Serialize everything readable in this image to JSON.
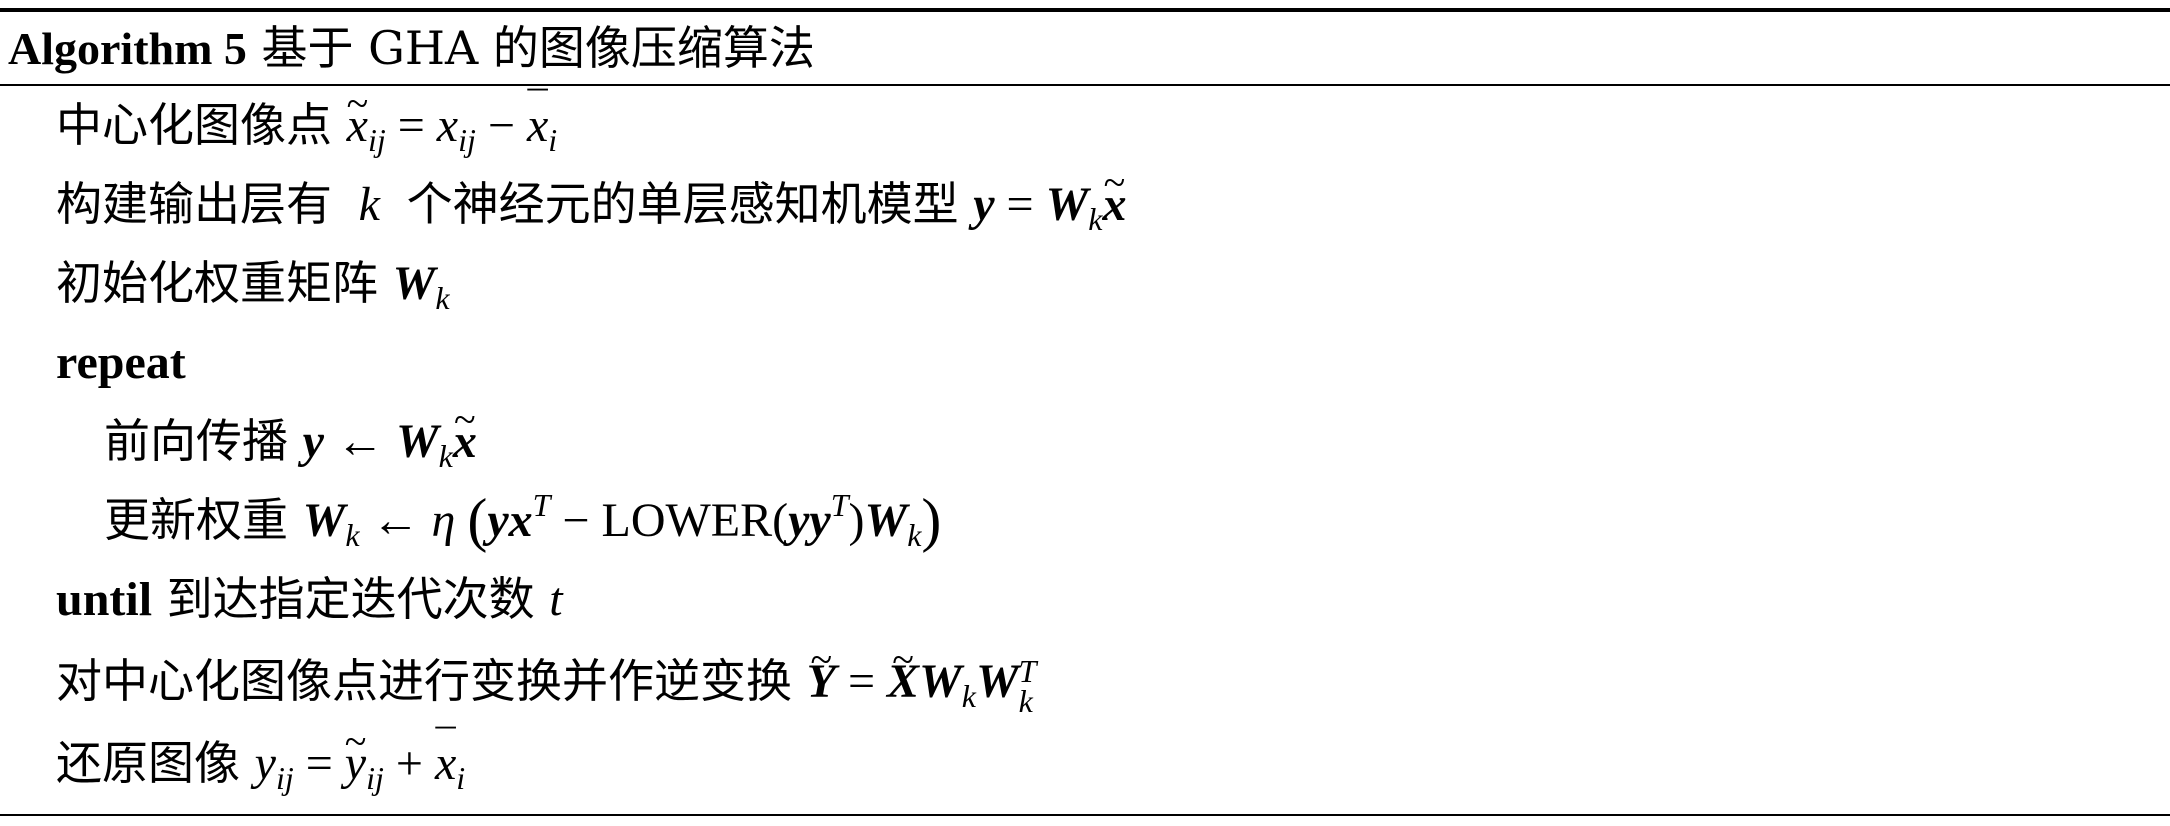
{
  "algorithm": {
    "label": "Algorithm 5",
    "title": "基于 GHA 的图像压缩算法"
  },
  "steps": {
    "center": "中心化图像点",
    "build_pre": "构建输出层有",
    "build_post": "个神经元的单层感知机模型",
    "init": "初始化权重矩阵",
    "repeat_kw": "repeat",
    "forward": "前向传播",
    "update": "更新权重",
    "lower_op": "LOWER",
    "until_kw": "until",
    "until_text": "到达指定迭代次数",
    "transform": "对中心化图像点进行变换并作逆变换",
    "restore": "还原图像"
  }
}
